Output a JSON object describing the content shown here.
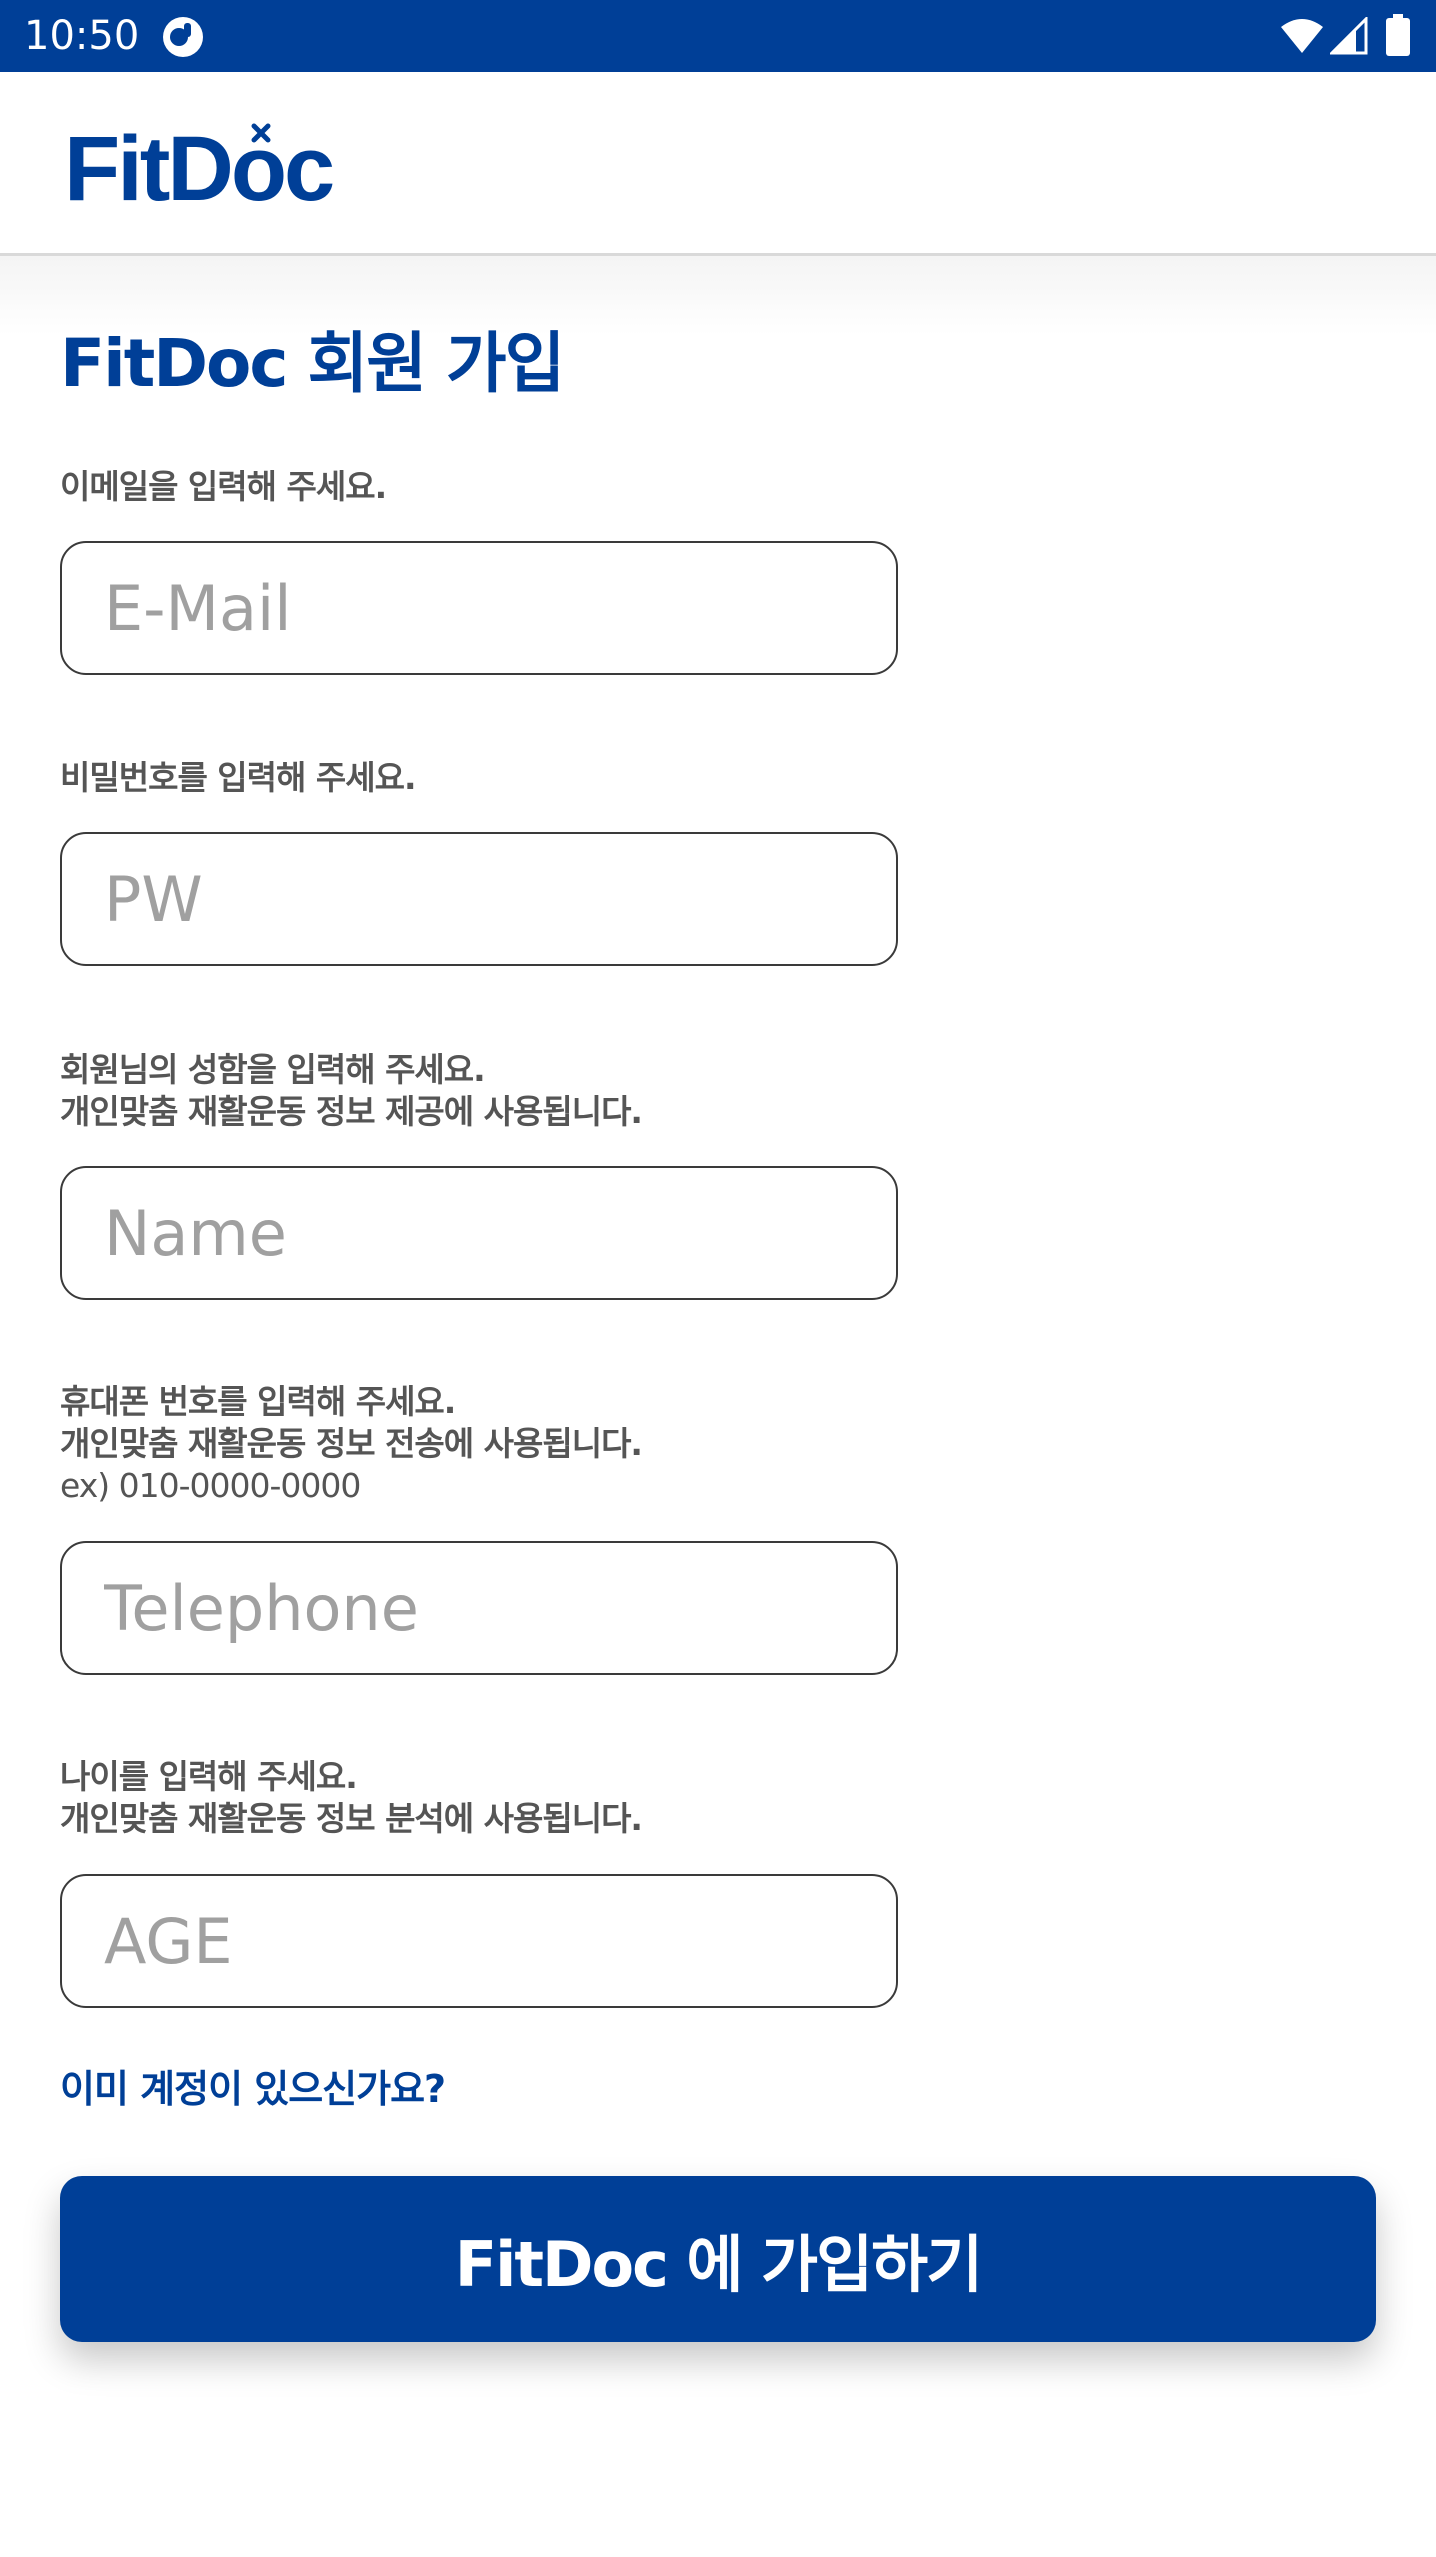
{
  "status_bar": {
    "time": "10:50",
    "icons": [
      "app-notification-icon",
      "wifi-icon",
      "signal-icon",
      "battery-icon"
    ]
  },
  "app_bar": {
    "logo_text": "FitDoc"
  },
  "form": {
    "title": "FitDoc 회원 가입",
    "email": {
      "label": "이메일을 입력해 주세요.",
      "placeholder": "E-Mail",
      "value": ""
    },
    "password": {
      "label": "비밀번호를 입력해 주세요.",
      "placeholder": "PW",
      "value": ""
    },
    "name": {
      "label_line1": "회원님의 성함을 입력해 주세요.",
      "label_line2": "개인맞춤 재활운동 정보 제공에 사용됩니다.",
      "placeholder": "Name",
      "value": ""
    },
    "telephone": {
      "label_line1": "휴대폰 번호를 입력해 주세요.",
      "label_line2": "개인맞춤 재활운동 정보 전송에 사용됩니다.",
      "label_line3": "ex) 010-0000-0000",
      "placeholder": "Telephone",
      "value": ""
    },
    "age": {
      "label_line1": "나이를 입력해 주세요.",
      "label_line2": "개인맞춤 재활운동 정보 분석에 사용됩니다.",
      "placeholder": "AGE",
      "value": ""
    },
    "login_link": "이미 계정이 있으신가요?",
    "submit_label": "FitDoc 에 가입하기"
  },
  "colors": {
    "brand": "#003f97",
    "label": "#555555",
    "placeholder": "#a0a0a0",
    "field_border": "#3a3a3a"
  }
}
